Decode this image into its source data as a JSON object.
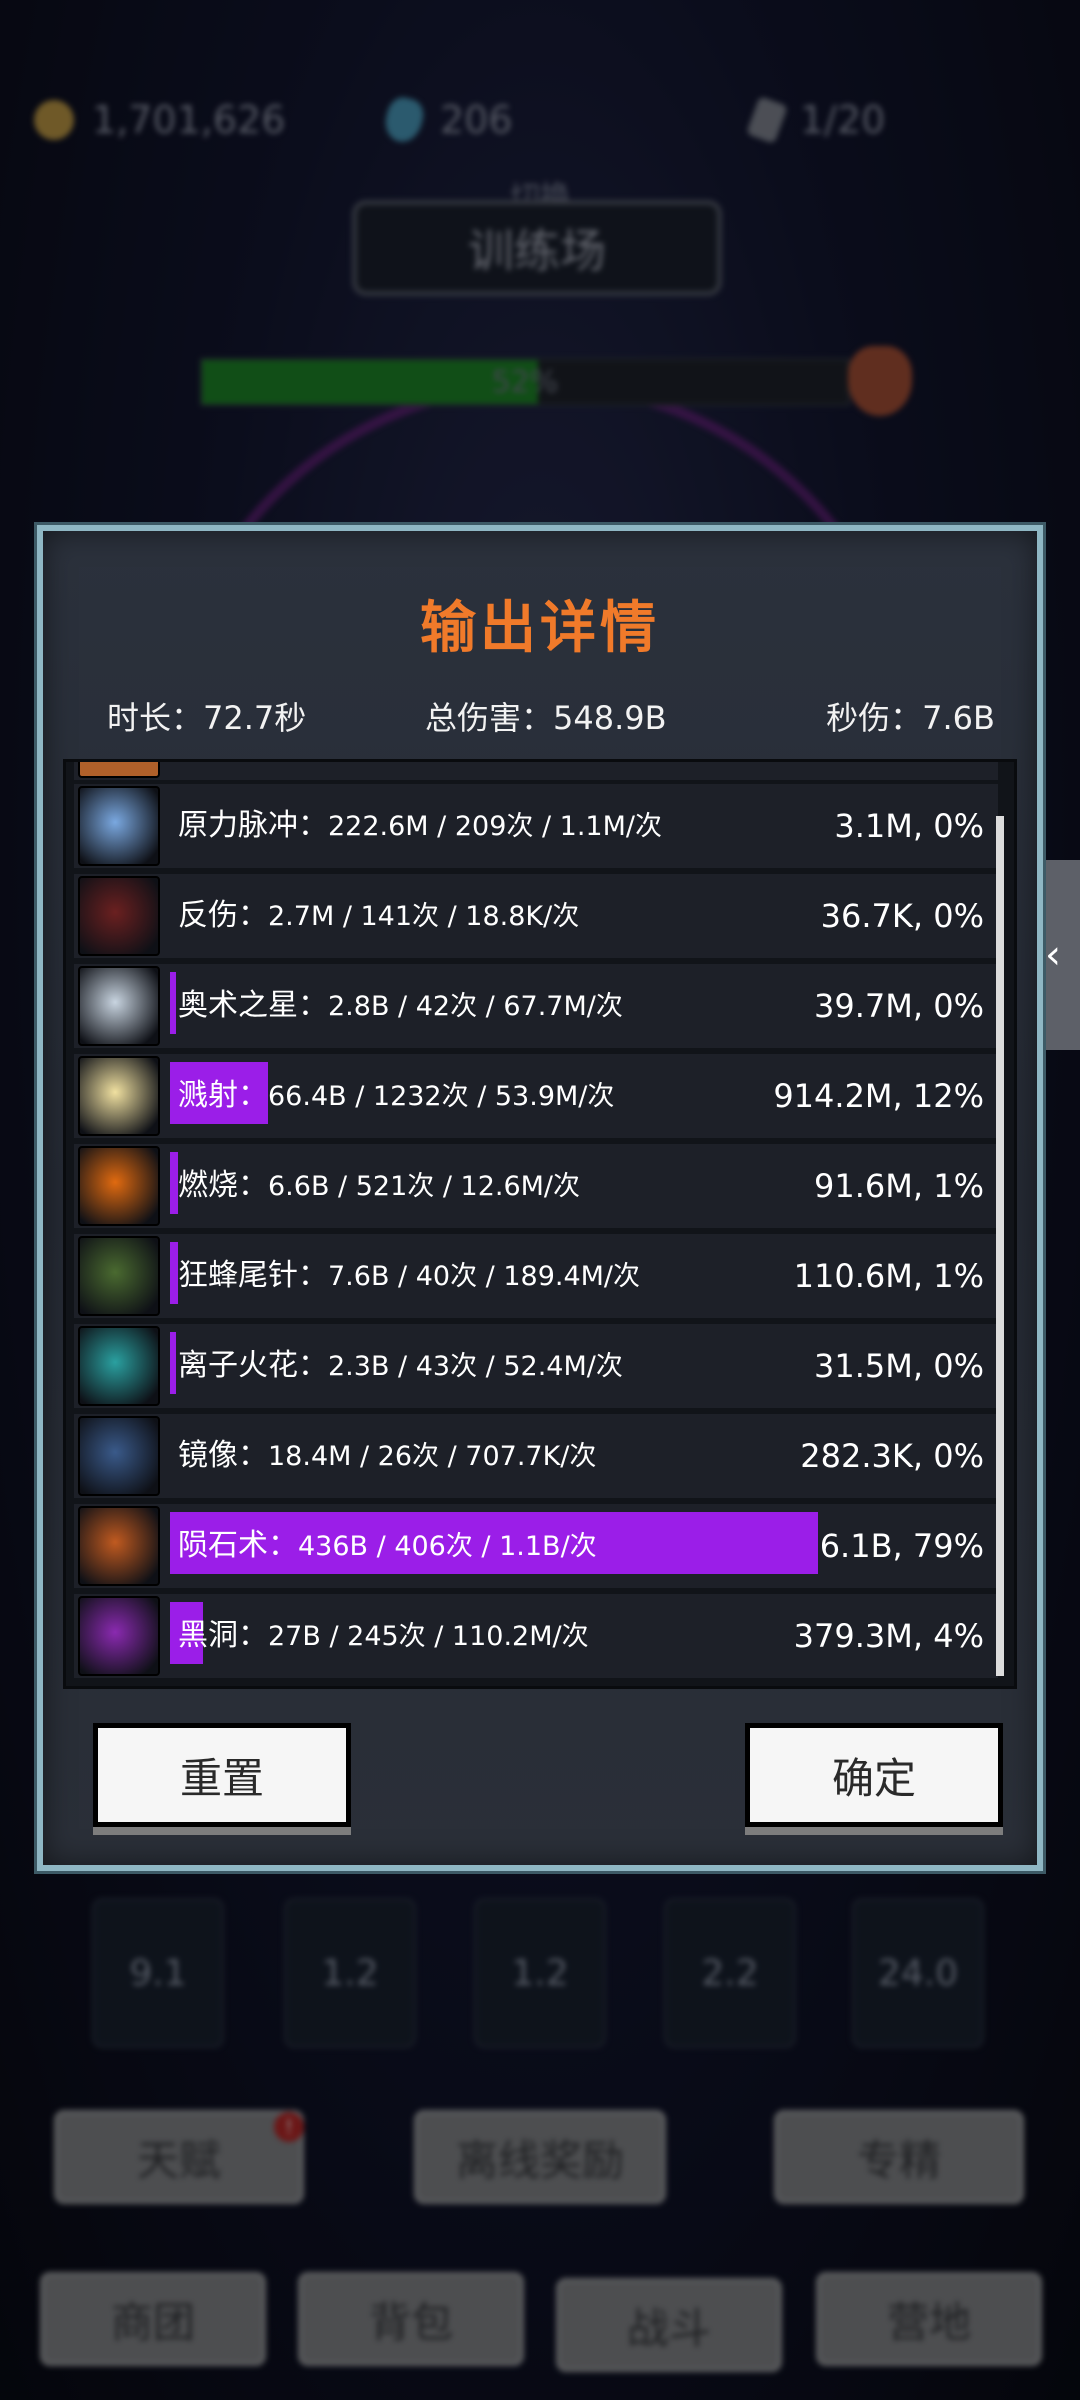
{
  "background": {
    "resources": [
      {
        "icon": "coin-icon",
        "value": "1,701,626"
      },
      {
        "icon": "gem-icon",
        "value": "206"
      },
      {
        "icon": "scroll-icon",
        "value": "1/20"
      }
    ],
    "switch_label": "切换",
    "location": "训练场",
    "boss_hp_text": "52%",
    "boss_hp_fraction": 0.52,
    "skill_slots": [
      "9.1",
      "1.2",
      "1.2",
      "2.2",
      "24.0"
    ],
    "actions": {
      "talent": "天赋",
      "talent_badge": "!",
      "offline_reward": "离线奖励",
      "mastery": "专精"
    },
    "nav": [
      "商团",
      "背包",
      "战斗",
      "营地"
    ]
  },
  "dialog": {
    "title": "输出详情",
    "duration": "时长：72.7秒",
    "total_damage": "总伤害：548.9B",
    "dps": "秒伤：7.6B",
    "skills": [
      {
        "name": "原力脉冲：",
        "detail": "222.6M  /  209次  /  1.1M/次",
        "dps_share": "3.1M, 0%",
        "share": 0.0,
        "icon": "force-pulse-icon",
        "color": "#7aa8e0"
      },
      {
        "name": "反伤：",
        "detail": "2.7M  /  141次  /  18.8K/次",
        "dps_share": "36.7K, 0%",
        "share": 0.0,
        "icon": "thorns-icon",
        "color": "#6b2020"
      },
      {
        "name": "奥术之星：",
        "detail": "2.8B  /  42次  /  67.7M/次",
        "dps_share": "39.7M, 0%",
        "share": 0.005,
        "icon": "arcane-star-icon",
        "color": "#c8d4e0"
      },
      {
        "name": "溅射：",
        "detail": "66.4B  /  1232次  /  53.9M/次",
        "dps_share": "914.2M, 12%",
        "share": 0.12,
        "icon": "splash-icon",
        "color": "#f0e0a0"
      },
      {
        "name": "燃烧：",
        "detail": "6.6B  /  521次  /  12.6M/次",
        "dps_share": "91.6M, 1%",
        "share": 0.01,
        "icon": "burn-icon",
        "color": "#e06a10"
      },
      {
        "name": "狂蜂尾针：",
        "detail": "7.6B  /  40次  /  189.4M/次",
        "dps_share": "110.6M, 1%",
        "share": 0.01,
        "icon": "bee-sting-icon",
        "color": "#4a6a30"
      },
      {
        "name": "离子火花：",
        "detail": "2.3B  /  43次  /  52.4M/次",
        "dps_share": "31.5M, 0%",
        "share": 0.005,
        "icon": "ion-spark-icon",
        "color": "#2aa0a0"
      },
      {
        "name": "镜像：",
        "detail": "18.4M  /  26次  /  707.7K/次",
        "dps_share": "282.3K, 0%",
        "share": 0.0,
        "icon": "mirror-image-icon",
        "color": "#3a5a8a"
      },
      {
        "name": "陨石术：",
        "detail": "436B  /  406次  /  1.1B/次",
        "dps_share": "6.1B, 79%",
        "share": 0.79,
        "icon": "meteor-icon",
        "color": "#c05a20"
      },
      {
        "name": "黑洞：",
        "detail": "27B  /  245次  /  110.2M/次",
        "dps_share": "379.3M, 4%",
        "share": 0.04,
        "icon": "black-hole-icon",
        "color": "#8a2ab0"
      }
    ],
    "reset_label": "重置",
    "confirm_label": "确定"
  }
}
